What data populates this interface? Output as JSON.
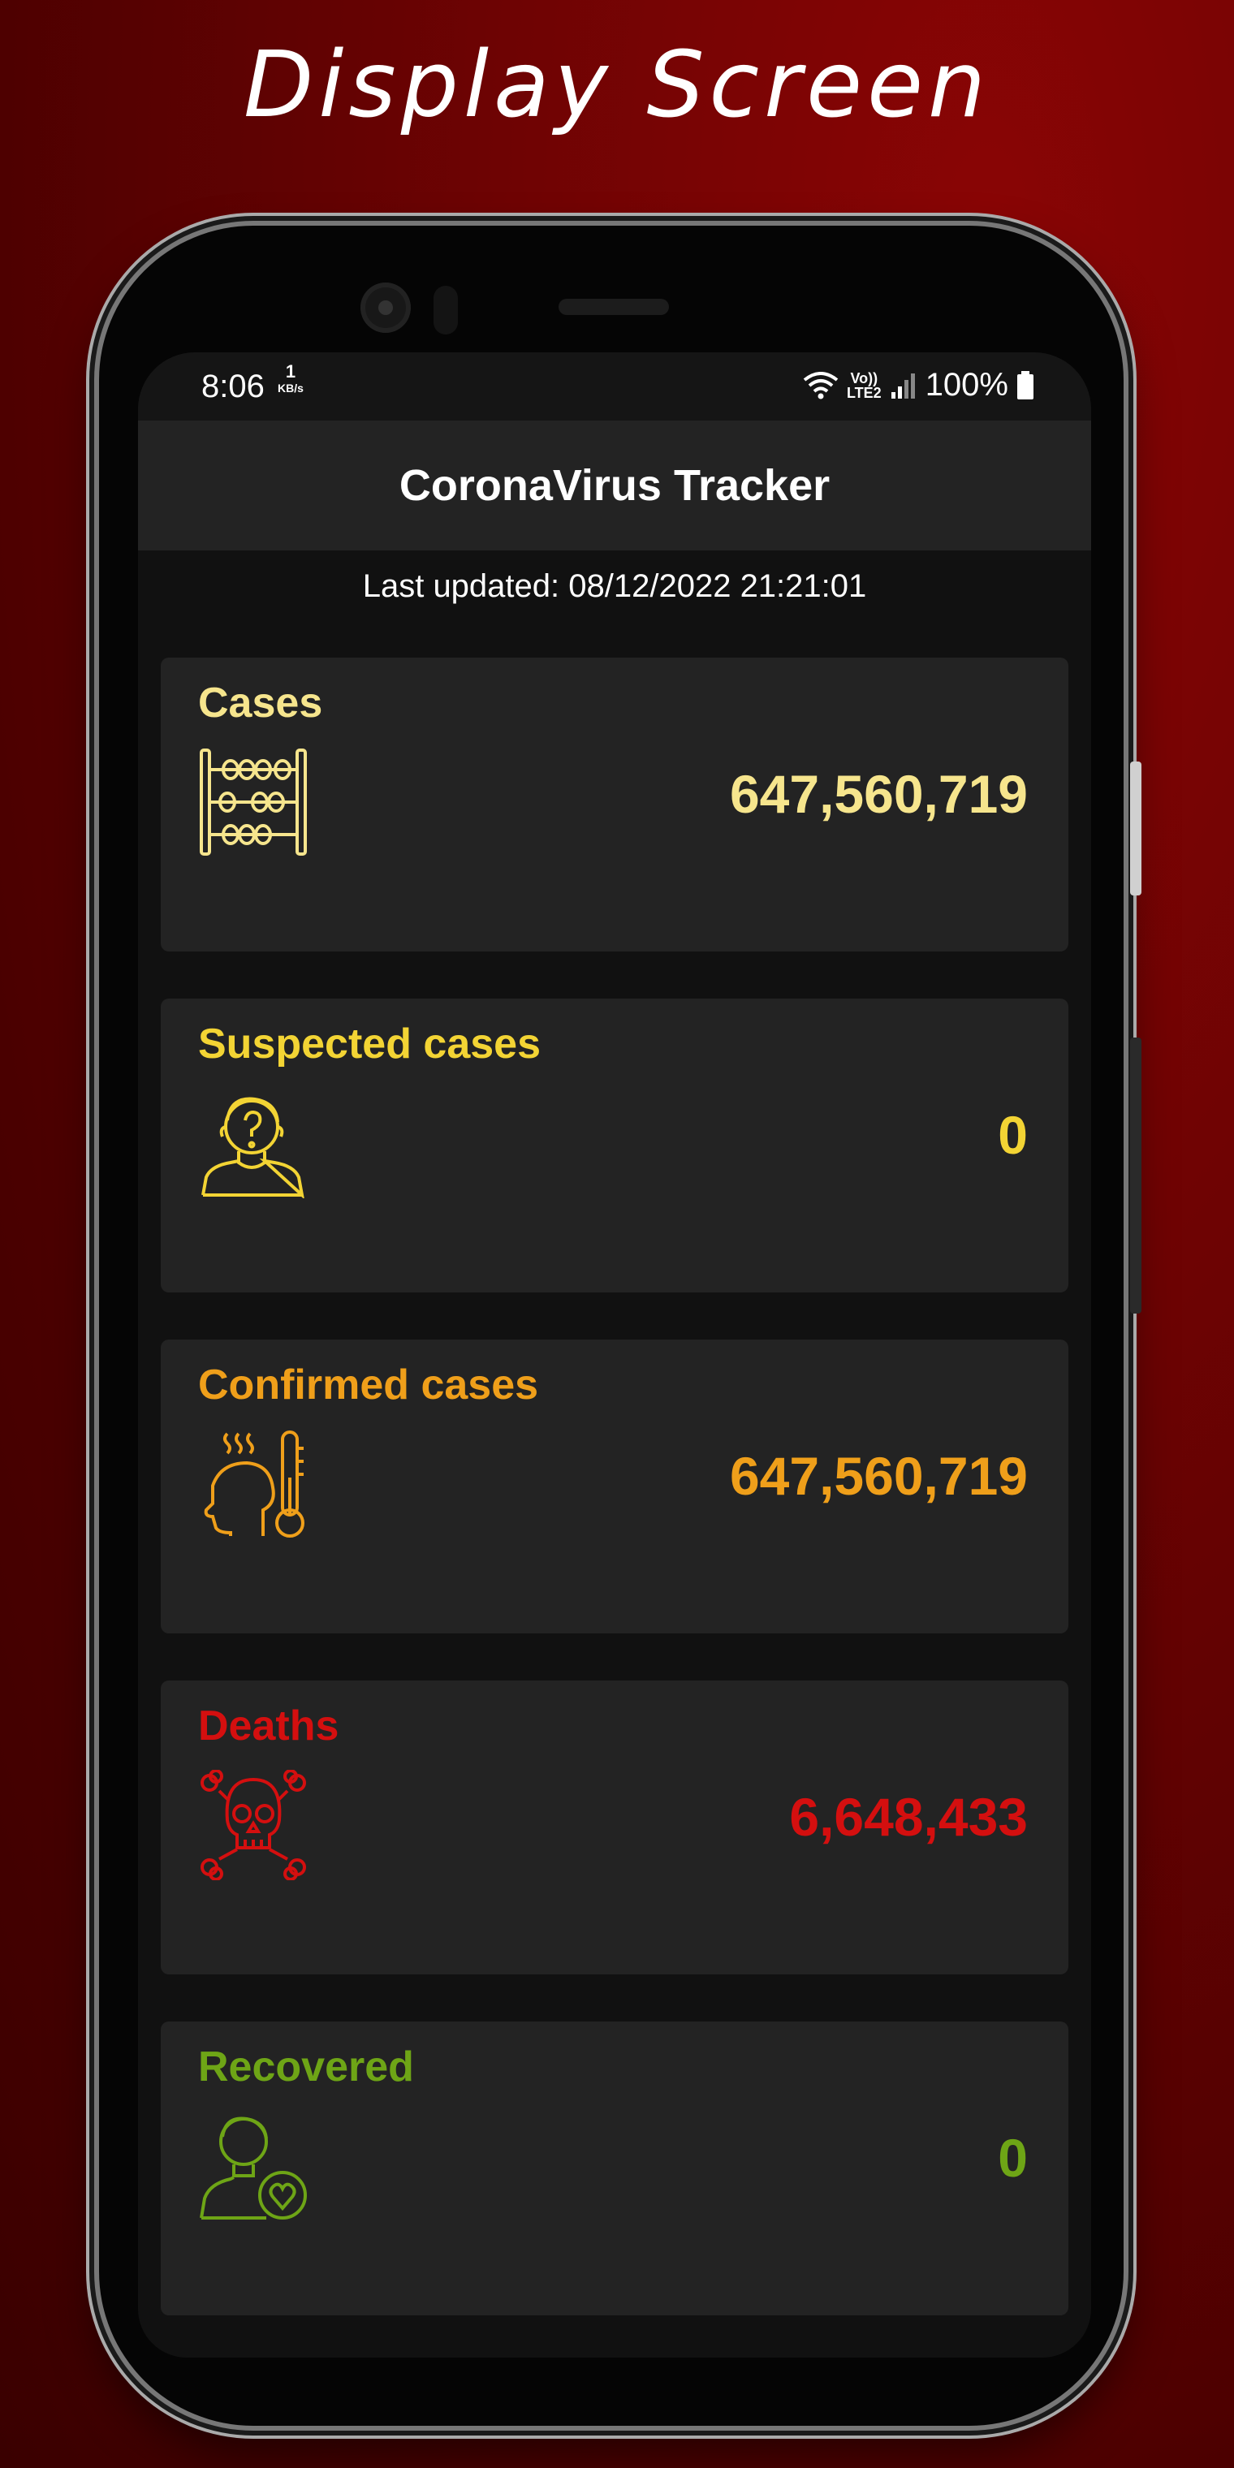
{
  "headline": "Display Screen",
  "status_bar": {
    "time": "8:06",
    "net_speed_value": "1",
    "net_speed_unit": "KB/s",
    "volte_top": "Vo))",
    "volte_bottom": "LTE2",
    "battery": "100%"
  },
  "app": {
    "title": "CoronaVirus Tracker",
    "last_updated": "Last updated: 08/12/2022 21:21:01"
  },
  "cards": [
    {
      "label": "Cases",
      "value": "647,560,719",
      "color": "#f6e58d",
      "icon": "abacus-icon"
    },
    {
      "label": "Suspected cases",
      "value": "0",
      "color": "#f3d434",
      "icon": "suspected-person-icon"
    },
    {
      "label": "Confirmed cases",
      "value": "647,560,719",
      "color": "#ef9f1a",
      "icon": "fever-thermometer-icon"
    },
    {
      "label": "Deaths",
      "value": "6,648,433",
      "color": "#d40f0f",
      "icon": "skull-crossbones-icon"
    },
    {
      "label": "Recovered",
      "value": "0",
      "color": "#6ea516",
      "icon": "recovered-person-icon"
    }
  ]
}
